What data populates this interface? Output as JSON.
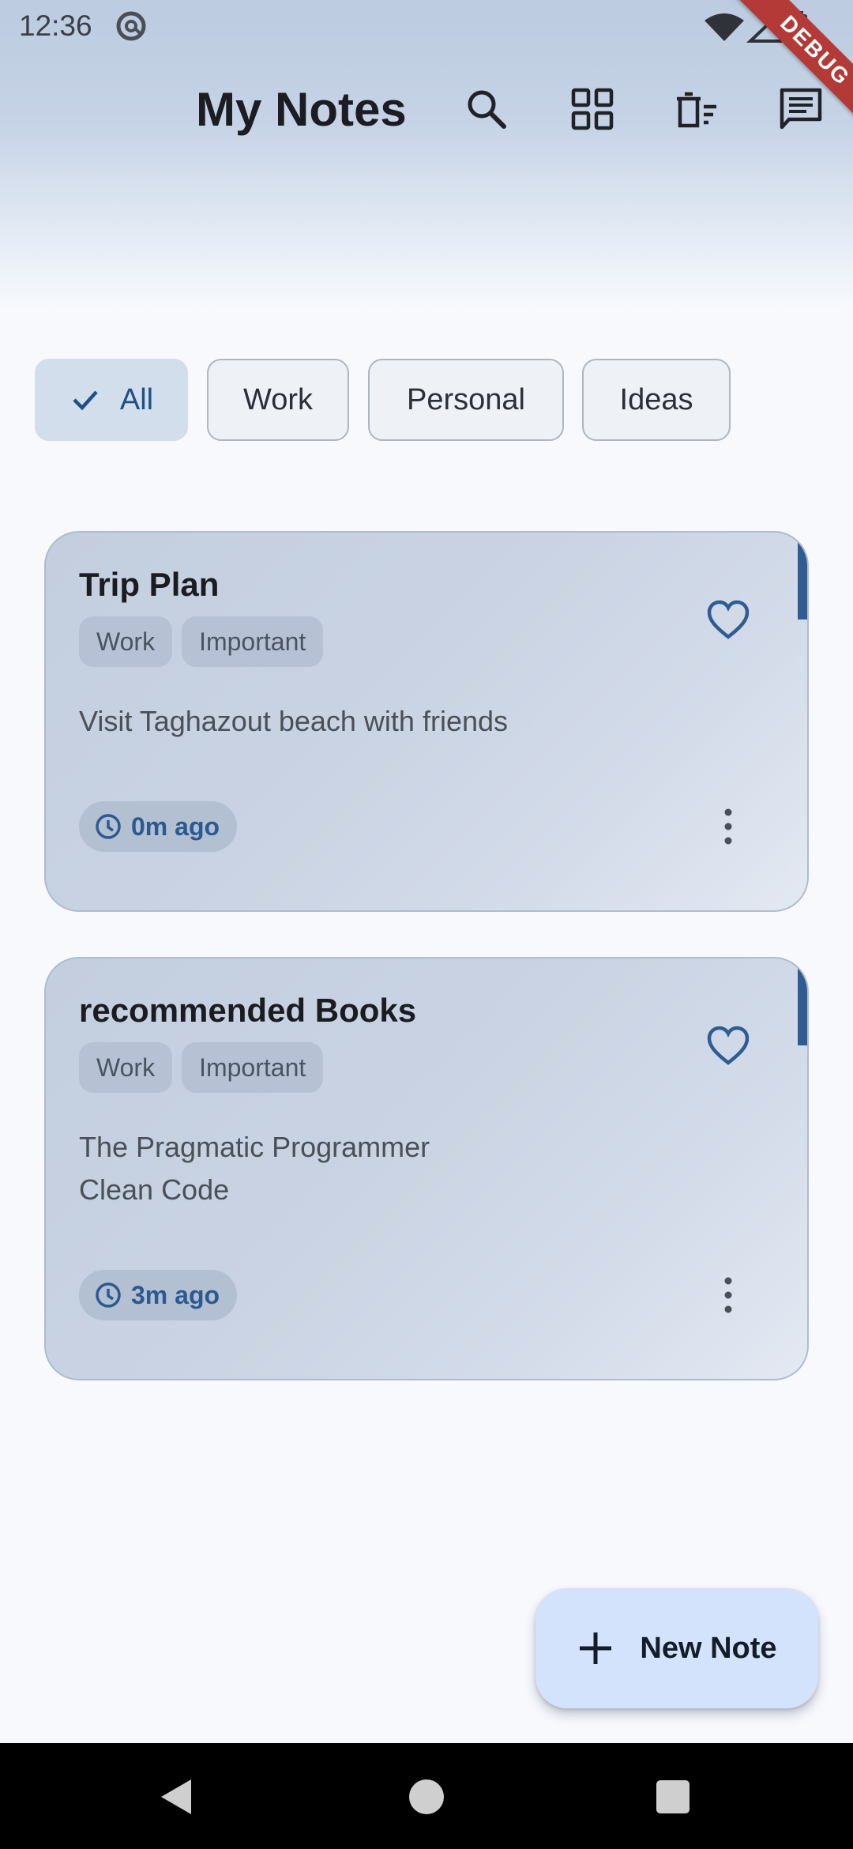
{
  "status_bar": {
    "time": "12:36"
  },
  "debug_banner": "DEBUG",
  "app_bar": {
    "title": "My Notes"
  },
  "filters": [
    {
      "label": "All",
      "selected": true
    },
    {
      "label": "Work",
      "selected": false
    },
    {
      "label": "Personal",
      "selected": false
    },
    {
      "label": "Ideas",
      "selected": false
    }
  ],
  "notes": [
    {
      "title": "Trip Plan",
      "tags": [
        "Work",
        "Important"
      ],
      "body": "Visit Taghazout beach with friends",
      "time": "0m ago",
      "favorite": false
    },
    {
      "title": "recommended Books",
      "tags": [
        "Work",
        "Important"
      ],
      "body": "The Pragmatic Programmer\nClean Code",
      "time": "3m ago",
      "favorite": false
    }
  ],
  "fab": {
    "label": "New Note"
  },
  "colors": {
    "accent": "#2f5c92",
    "chip_selected_bg": "#d2deec",
    "fab_bg": "#d3e3fb",
    "debug_banner": "#b33a36"
  }
}
